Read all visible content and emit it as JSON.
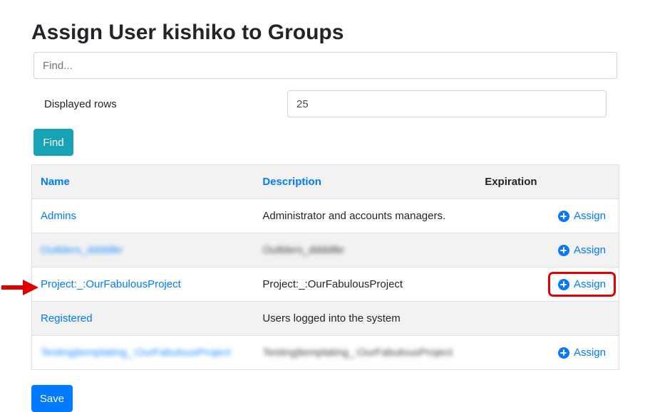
{
  "page": {
    "title": "Assign User kishiko to Groups"
  },
  "search": {
    "placeholder": "Find...",
    "value": ""
  },
  "rows": {
    "label": "Displayed rows",
    "value": "25"
  },
  "buttons": {
    "find": "Find",
    "save": "Save"
  },
  "table": {
    "headers": {
      "name": "Name",
      "description": "Description",
      "expiration": "Expiration"
    },
    "rows": [
      {
        "name": "Admins",
        "description": "Administrator and accounts managers.",
        "action": "Assign",
        "blurred": false
      },
      {
        "name": "Outlders_ddddtkr",
        "description": "Outlders_ddddtkr",
        "action": "Assign",
        "blurred": true
      },
      {
        "name": "Project:_:OurFabulousProject",
        "description": "Project:_:OurFabulousProject",
        "action": "Assign",
        "blurred": false
      },
      {
        "name": "Registered",
        "description": "Users logged into the system",
        "action": "",
        "blurred": false
      },
      {
        "name": "Testing|templating_:OurFabulousProject",
        "description": "Testing|templating_:OurFabulousProject",
        "action": "Assign",
        "blurred": true
      }
    ]
  },
  "colors": {
    "primary": "#007bff",
    "info": "#17a2b8",
    "highlight": "#e00000"
  },
  "icons": {
    "assign": "plus-circle-icon",
    "pointer": "red-arrow-icon"
  }
}
